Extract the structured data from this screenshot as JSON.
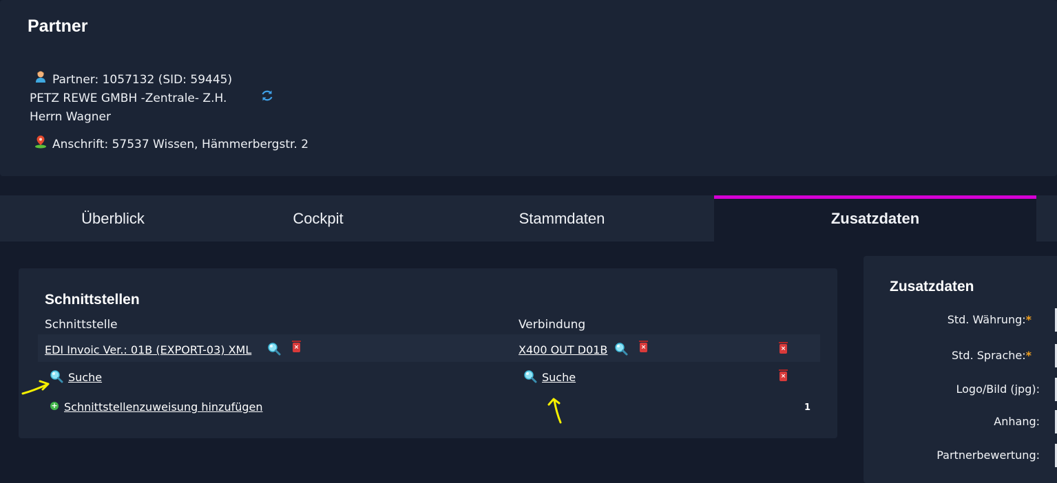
{
  "header": {
    "title": "Partner",
    "partner_line": "Partner: 1057132 (SID: 59445)",
    "company": "PETZ REWE GMBH -Zentrale- Z.H.",
    "contact": "Herrn Wagner",
    "address_line": "Anschrift: 57537 Wissen, Hämmerbergstr. 2"
  },
  "tabs": [
    {
      "label": "Überblick"
    },
    {
      "label": "Cockpit"
    },
    {
      "label": "Stammdaten"
    },
    {
      "label": "Zusatzdaten",
      "active": true
    }
  ],
  "interfaces": {
    "title": "Schnittstellen",
    "col_interface": "Schnittstelle",
    "col_connection": "Verbindung",
    "row1": {
      "interface": "EDI Invoic Ver.: 01B (EXPORT-03) XML",
      "connection": "X400 OUT D01B"
    },
    "row2": {
      "interface_search": "Suche",
      "connection_search": "Suche"
    },
    "add_label": "Schnittstellenzuweisung hinzufügen",
    "count": "1"
  },
  "extra": {
    "title": "Zusatzdaten",
    "fields": [
      {
        "label": "Std. Währung:",
        "required": true
      },
      {
        "label": "Std. Sprache:",
        "required": true
      },
      {
        "label": "Logo/Bild (jpg):",
        "required": false
      },
      {
        "label": "Anhang:",
        "required": false
      },
      {
        "label": "Partnerbewertung:",
        "required": false
      }
    ],
    "required_mark": "*"
  },
  "colors": {
    "background": "#141b2b",
    "panel": "#1b2435",
    "active_tab_indicator": "#d400d4",
    "required_mark": "#f0a020",
    "annotation_arrow": "#f5f000"
  },
  "icons": [
    "person-icon",
    "refresh-icon",
    "location-pin-icon",
    "search-icon",
    "delete-icon",
    "add-icon",
    "annotation-arrow"
  ]
}
